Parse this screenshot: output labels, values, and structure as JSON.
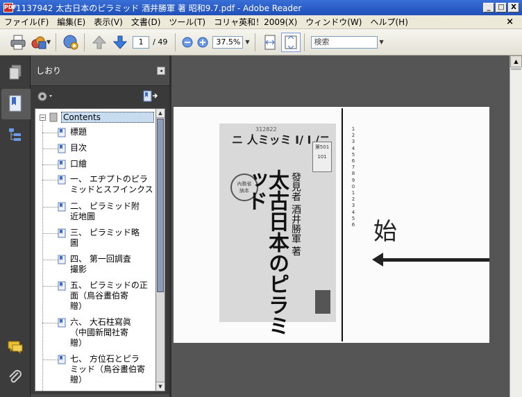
{
  "window": {
    "title": "1137942 太古日本のピラミッド 酒井勝軍 著 昭和9.7.pdf - Adobe Reader",
    "app_icon_label": "PDF",
    "minimize": "_",
    "maximize": "□",
    "close": "X"
  },
  "menu": {
    "items": [
      "ファイル(F)",
      "編集(E)",
      "表示(V)",
      "文書(D)",
      "ツール(T)",
      "コリャ英和！2009(X)",
      "ウィンドウ(W)",
      "ヘルプ(H)"
    ],
    "close": "×"
  },
  "toolbar": {
    "current_page": "1",
    "total_pages": "/ 49",
    "zoom": "37.5%",
    "search_placeholder": "検索"
  },
  "panel": {
    "title": "しおり",
    "collapse": "◂",
    "root_label": "Contents",
    "items": [
      "標題",
      "目次",
      "口繪",
      "一、 エヂプトのピラ\nミッドとスフインクス",
      "二、 ピラミッド附\n近地圖",
      "三、 ピラミッド略\n圖",
      "四、 第一回調査\n撮影",
      "五、 ピラミッドの正\n面（鳥谷畫伯寄\n贈）",
      "六、 大石柱寫眞\n（中國新聞社寄\n贈）",
      "七、 方位石とピラ\nミッド（鳥谷畫伯寄\n贈）"
    ]
  },
  "document": {
    "cover_number": "312822",
    "cover_top": "ニ 人ミッミ I/ I /ニ",
    "cover_title": "太古日本のピラミッド",
    "cover_author": "發見者 酒井勝軍 著",
    "label_lines": "第501\n101",
    "stamp_text": "內務省\n納本",
    "ruler_digits": "1\n2\n3\n4\n5\n6\n7\n8\n9\n0\n1\n2\n3\n4\n5\n6",
    "annotation": "始"
  }
}
